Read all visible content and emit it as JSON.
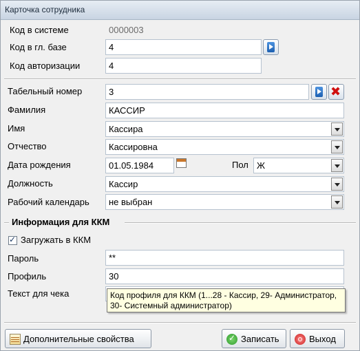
{
  "window": {
    "title": "Карточка сотрудника"
  },
  "system_id": {
    "label": "Код в системе",
    "value": "0000003"
  },
  "main_db_id": {
    "label": "Код в гл. базе",
    "value": "4"
  },
  "auth_id": {
    "label": "Код авторизации",
    "value": "4"
  },
  "personnel_number": {
    "label": "Табельный номер",
    "value": "3"
  },
  "last_name": {
    "label": "Фамилия",
    "value": "КАССИР"
  },
  "first_name": {
    "label": "Имя",
    "value": "Кассира"
  },
  "patronymic": {
    "label": "Отчество",
    "value": "Кассировна"
  },
  "birth_date": {
    "label": "Дата рождения",
    "value": "01.05.1984"
  },
  "gender": {
    "label": "Пол",
    "value": "Ж"
  },
  "position": {
    "label": "Должность",
    "value": "Кассир"
  },
  "work_calendar": {
    "label": "Рабочий календарь",
    "value": "не выбран"
  },
  "kkm_section": {
    "title": "Информация для ККМ",
    "load_checkbox_label": "Загружать в ККМ",
    "load_checked": true
  },
  "password": {
    "label": "Пароль",
    "value": "**"
  },
  "profile": {
    "label": "Профиль",
    "value": "30"
  },
  "receipt_text": {
    "label": "Текст для чека",
    "value": ""
  },
  "tooltip": {
    "text": "Код профиля для ККМ (1...28 - Кассир, 29- Администратор, 30- Системный администратор)"
  },
  "buttons": {
    "additional_props": "Дополнительные свойства",
    "save": "Записать",
    "exit": "Выход"
  },
  "icons": {
    "navigate": "arrow-right-icon",
    "delete": "delete-x-icon",
    "calendar": "calendar-icon",
    "props": "properties-icon",
    "save": "save-check-icon",
    "exit": "exit-icon"
  }
}
